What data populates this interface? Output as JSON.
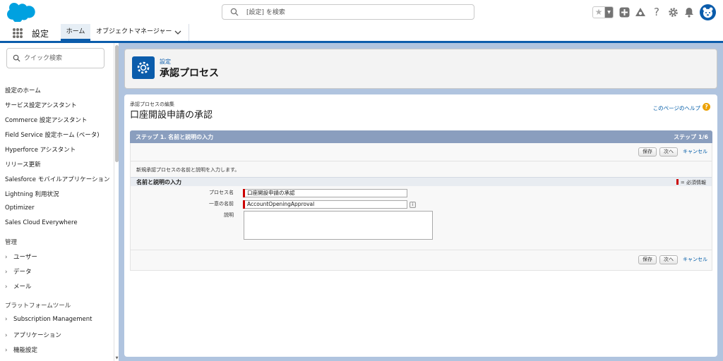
{
  "header": {
    "search_placeholder": "[設定] を検索",
    "brand_color": "#0b5cab"
  },
  "nav": {
    "app_name": "設定",
    "tabs": [
      {
        "label": "ホーム"
      },
      {
        "label": "オブジェクトマネージャー"
      }
    ]
  },
  "sidebar": {
    "quick_find_placeholder": "クイック検索",
    "items": [
      "設定のホーム",
      "サービス設定アシスタント",
      "Commerce 設定アシスタント",
      "Field Service 設定ホーム (ベータ)",
      "Hyperforce アシスタント",
      "リリース更新",
      "Salesforce モバイルアプリケーション",
      "Lightning 利用状況",
      "Optimizer",
      "Sales Cloud Everywhere"
    ],
    "admin_heading": "管理",
    "admin_items": [
      "ユーザー",
      "データ",
      "メール"
    ],
    "platform_heading": "プラットフォームツール",
    "platform_items": [
      "Subscription Management",
      "アプリケーション",
      "機能設定"
    ]
  },
  "page_header": {
    "eyebrow": "設定",
    "title": "承認プロセス"
  },
  "main": {
    "subtitle": "承認プロセスの編集",
    "title": "口座開設申請の承認",
    "help_link": "このページのヘルプ",
    "step_title": "ステップ 1. 名前と説明の入力",
    "step_count": "ステップ 1/6",
    "buttons": {
      "save": "保存",
      "next": "次へ",
      "cancel": "キャンセル"
    },
    "intro": "新規承認プロセスの名前と説明を入力します。",
    "section_title": "名前と説明の入力",
    "required_label": "= 必須情報",
    "fields": {
      "process_name_label": "プロセス名",
      "process_name_value": "口座開設申請の承認",
      "unique_name_label": "一意の名前",
      "unique_name_value": "AccountOpeningApproval",
      "description_label": "説明",
      "description_value": ""
    }
  }
}
